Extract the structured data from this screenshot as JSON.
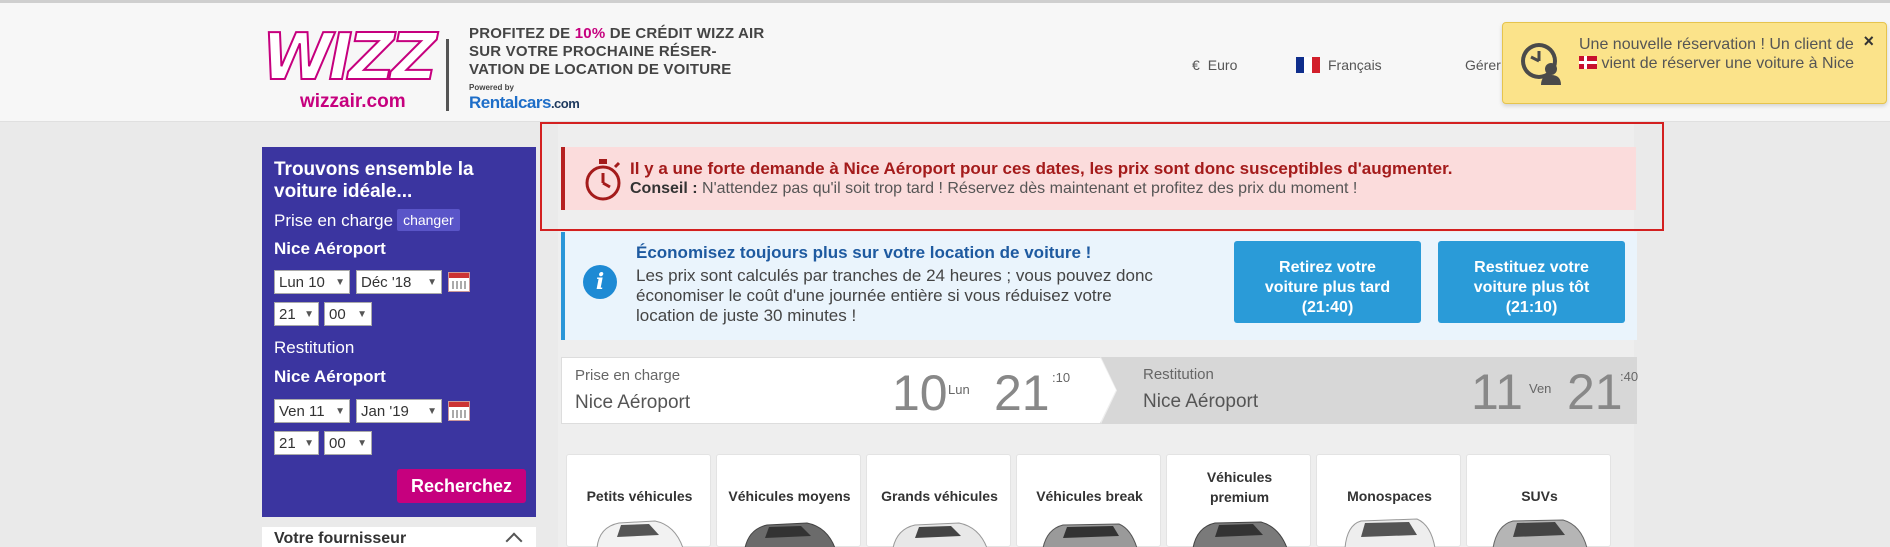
{
  "header": {
    "logo_brand": "WIZZ",
    "logo_domain": "wizzair.com",
    "promo_part1": "PROFITEZ DE ",
    "promo_pct": "10%",
    "promo_part2": " DE CRÉDIT WIZZ AIR SUR VOTRE PROCHAINE RÉSER-VATION DE LOCATION DE VOITURE",
    "powered_by": "Powered by",
    "rentalcars": "Rentalcars",
    "rentalcars_domain": ".com",
    "currency_symbol": "€",
    "currency": "Euro",
    "language": "Français",
    "manage": "Gérer"
  },
  "toast": {
    "text_before_flag": "Une nouvelle réservation ! Un client de",
    "text_after_flag": " vient de réserver une voiture à Nice",
    "close": "×"
  },
  "sidebar": {
    "title": "Trouvons ensemble la voiture idéale...",
    "pickup_label": "Prise en charge",
    "change_chip": "changer",
    "pickup_location": "Nice Aéroport",
    "pickup_day": "Lun 10",
    "pickup_month": "Déc '18",
    "pickup_hour": "21",
    "pickup_minute": "00",
    "dropoff_label": "Restitution",
    "dropoff_location": "Nice Aéroport",
    "dropoff_day": "Ven 11",
    "dropoff_month": "Jan '19",
    "dropoff_hour": "21",
    "dropoff_minute": "00",
    "search_button": "Recherchez",
    "provider_title": "Votre fournisseur"
  },
  "alert": {
    "title": "Il y a une forte demande à Nice Aéroport pour ces dates, les prix sont donc susceptibles d'augmenter.",
    "tip_label": "Conseil :",
    "tip_text": " N'attendez pas qu'il soit trop tard ! Réservez dès maintenant et profitez des prix du moment !"
  },
  "info": {
    "title": "Économisez toujours plus sur votre location de voiture !",
    "text": "Les prix sont calculés par tranches de 24 heures ; vous pouvez donc économiser le coût d'une journée entière si vous réduisez votre location de juste 30 minutes !",
    "later_button_line1": "Retirez votre",
    "later_button_line2": "voiture plus tard",
    "later_button_line3": "(21:40)",
    "earlier_button_line1": "Restituez votre",
    "earlier_button_line2": "voiture plus tôt",
    "earlier_button_line3": "(21:10)"
  },
  "summary": {
    "pickup_label": "Prise en charge",
    "pickup_location": "Nice Aéroport",
    "pickup_day_num": "10",
    "pickup_day_name": "Lun",
    "pickup_hour": "21",
    "pickup_min": ":10",
    "dropoff_label": "Restitution",
    "dropoff_location": "Nice Aéroport",
    "dropoff_day_num": "11",
    "dropoff_day_name": "Ven",
    "dropoff_hour": "21",
    "dropoff_min": ":40"
  },
  "categories": [
    {
      "label": "Petits véhicules"
    },
    {
      "label": "Véhicules moyens"
    },
    {
      "label": "Grands véhicules"
    },
    {
      "label": "Véhicules break"
    },
    {
      "label_line1": "Véhicules",
      "label_line2": "premium"
    },
    {
      "label": "Monospaces"
    },
    {
      "label": "SUVs"
    }
  ],
  "colors": {
    "brand_magenta": "#c6007e",
    "sidebar_purple": "#3b35a0",
    "alert_red": "#b52020",
    "info_blue": "#2a9bd8",
    "toast_yellow": "#fbe38a"
  }
}
